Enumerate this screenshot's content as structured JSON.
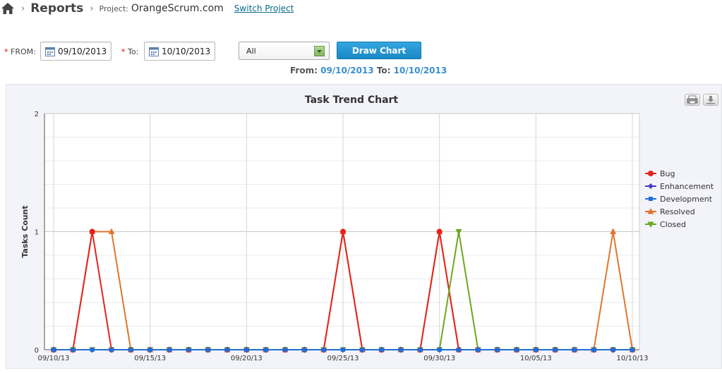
{
  "breadcrumb": {
    "title": "Reports",
    "project_label": "Project:",
    "project_name": "OrangeScrum.com",
    "switch_label": "Switch Project"
  },
  "filters": {
    "from_star": "*",
    "from_label": "FROM:",
    "from_value": "09/10/2013",
    "to_star": "*",
    "to_label": "To:",
    "to_value": "10/10/2013",
    "select_value": "All",
    "draw_button": "Draw Chart"
  },
  "range": {
    "from_label": "From:",
    "from_value": "09/10/2013",
    "to_label": "To:",
    "to_value": "10/10/2013"
  },
  "icons": [
    "home-icon",
    "calendar-icon",
    "dropdown-arrow-icon",
    "print-icon",
    "download-icon"
  ],
  "colors": {
    "accent_button": "#1a87c4",
    "link": "#3a8fd0",
    "bug": "#e5231d",
    "enhancement": "#4a39c4",
    "development": "#1f6fd6",
    "resolved": "#e0752e",
    "closed": "#6aa81e"
  },
  "chart_data": {
    "type": "line",
    "title": "Task Trend Chart",
    "xlabel": "",
    "ylabel": "Tasks Count",
    "x": [
      "09/10/13",
      "09/11/13",
      "09/12/13",
      "09/13/13",
      "09/14/13",
      "09/15/13",
      "09/16/13",
      "09/17/13",
      "09/18/13",
      "09/19/13",
      "09/20/13",
      "09/21/13",
      "09/22/13",
      "09/23/13",
      "09/24/13",
      "09/25/13",
      "09/26/13",
      "09/27/13",
      "09/28/13",
      "09/29/13",
      "09/30/13",
      "10/01/13",
      "10/02/13",
      "10/03/13",
      "10/04/13",
      "10/05/13",
      "10/06/13",
      "10/07/13",
      "10/08/13",
      "10/09/13",
      "10/10/13"
    ],
    "xticks": [
      "09/10/13",
      "09/15/13",
      "09/20/13",
      "09/25/13",
      "09/30/13",
      "10/05/13",
      "10/10/13"
    ],
    "yticks": [
      0,
      1,
      2
    ],
    "ylim": [
      0,
      2
    ],
    "grid": true,
    "legend_position": "right",
    "series": [
      {
        "name": "Bug",
        "color": "#e5231d",
        "marker": "circle",
        "values": [
          0,
          0,
          1,
          0,
          0,
          0,
          0,
          0,
          0,
          0,
          0,
          0,
          0,
          0,
          0,
          1,
          0,
          0,
          0,
          0,
          1,
          0,
          0,
          0,
          0,
          0,
          0,
          0,
          0,
          0,
          0
        ]
      },
      {
        "name": "Enhancement",
        "color": "#4a39c4",
        "marker": "diamond",
        "values": [
          0,
          0,
          0,
          0,
          0,
          0,
          0,
          0,
          0,
          0,
          0,
          0,
          0,
          0,
          0,
          0,
          0,
          0,
          0,
          0,
          0,
          0,
          0,
          0,
          0,
          0,
          0,
          0,
          0,
          0,
          0
        ]
      },
      {
        "name": "Development",
        "color": "#1f6fd6",
        "marker": "square",
        "values": [
          0,
          0,
          0,
          0,
          0,
          0,
          0,
          0,
          0,
          0,
          0,
          0,
          0,
          0,
          0,
          0,
          0,
          0,
          0,
          0,
          0,
          0,
          0,
          0,
          0,
          0,
          0,
          0,
          0,
          0,
          0
        ]
      },
      {
        "name": "Resolved",
        "color": "#e0752e",
        "marker": "triangle",
        "values": [
          0,
          0,
          1,
          1,
          0,
          0,
          0,
          0,
          0,
          0,
          0,
          0,
          0,
          0,
          0,
          1,
          0,
          0,
          0,
          0,
          1,
          0,
          0,
          0,
          0,
          0,
          0,
          0,
          0,
          1,
          0
        ]
      },
      {
        "name": "Closed",
        "color": "#6aa81e",
        "marker": "triangle-down",
        "values": [
          0,
          0,
          0,
          0,
          0,
          0,
          0,
          0,
          0,
          0,
          0,
          0,
          0,
          0,
          0,
          0,
          0,
          0,
          0,
          0,
          0,
          1,
          0,
          0,
          0,
          0,
          0,
          0,
          0,
          0,
          0
        ]
      }
    ]
  }
}
